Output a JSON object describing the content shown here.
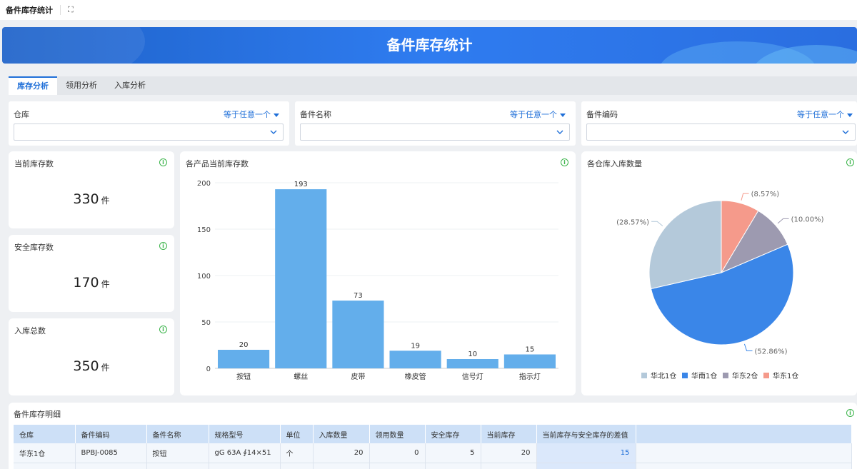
{
  "app": {
    "title": "备件库存统计",
    "fullscreen_icon": "fullscreen-icon"
  },
  "banner": {
    "title": "备件库存统计"
  },
  "tabs": [
    {
      "label": "库存分析",
      "active": true
    },
    {
      "label": "领用分析",
      "active": false
    },
    {
      "label": "入库分析",
      "active": false
    }
  ],
  "filters": [
    {
      "label": "仓库",
      "operator": "等于任意一个",
      "value": ""
    },
    {
      "label": "备件名称",
      "operator": "等于任意一个",
      "value": ""
    },
    {
      "label": "备件编码",
      "operator": "等于任意一个",
      "value": ""
    }
  ],
  "kpis": [
    {
      "title": "当前库存数",
      "value": "330",
      "unit": "件"
    },
    {
      "title": "安全库存数",
      "value": "170",
      "unit": "件"
    },
    {
      "title": "入库总数",
      "value": "350",
      "unit": "件"
    }
  ],
  "info_icon": "i",
  "chart_data": [
    {
      "type": "bar",
      "title": "各产品当前库存数",
      "categories": [
        "按钮",
        "螺丝",
        "皮带",
        "橡皮管",
        "信号灯",
        "指示灯"
      ],
      "values": [
        20,
        193,
        73,
        19,
        10,
        15
      ],
      "ylim": [
        0,
        200
      ],
      "yticks": [
        0,
        50,
        100,
        150,
        200
      ],
      "color": "#63aeeb",
      "grid": true
    },
    {
      "type": "pie",
      "title": "各仓库入库数量",
      "slices": [
        {
          "name": "华北1仓",
          "value": 28.57,
          "label": "(28.57%)",
          "color": "#b4c9da"
        },
        {
          "name": "华南1仓",
          "value": 52.86,
          "label": "(52.86%)",
          "color": "#3a86e8"
        },
        {
          "name": "华东2仓",
          "value": 10.0,
          "label": "(10.00%)",
          "color": "#9d9ab0"
        },
        {
          "name": "华东1仓",
          "value": 8.57,
          "label": "(8.57%)",
          "color": "#f59a8b"
        }
      ],
      "legend": "bottom"
    }
  ],
  "detail": {
    "title": "备件库存明细",
    "columns": [
      "仓库",
      "备件编码",
      "备件名称",
      "规格型号",
      "单位",
      "入库数量",
      "领用数量",
      "安全库存",
      "当前库存",
      "当前库存与安全库存的差值"
    ],
    "rows": [
      [
        "华东1仓",
        "BPBJ-0085",
        "按钮",
        "gG 63A ∮14×51",
        "个",
        "20",
        "0",
        "5",
        "20",
        "15"
      ]
    ]
  }
}
